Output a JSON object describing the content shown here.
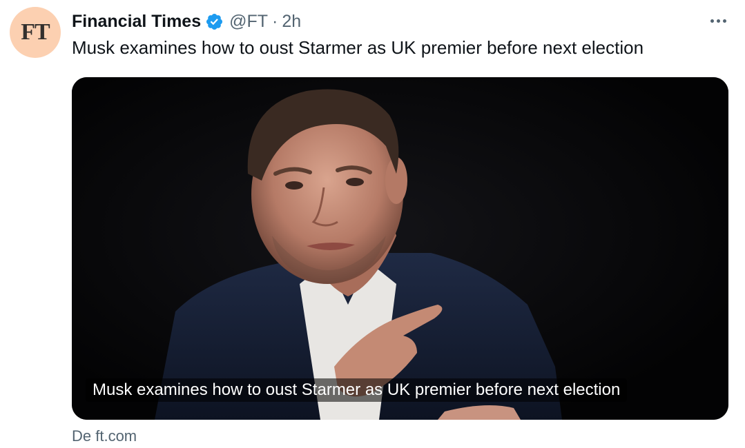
{
  "account": {
    "avatar_text": "FT",
    "name": "Financial Times",
    "handle": "@FT",
    "separator": "·",
    "time": "2h",
    "verified_icon": "verified-badge-icon",
    "avatar_color": "#fcd0b1",
    "verified_color": "#1d9bf0"
  },
  "menu": {
    "icon": "more-options-icon"
  },
  "tweet": {
    "text": "Musk examines how to oust Starmer as UK premier before next election"
  },
  "card": {
    "caption": "Musk examines how to oust Starmer as UK premier before next election",
    "source": "De ft.com"
  }
}
